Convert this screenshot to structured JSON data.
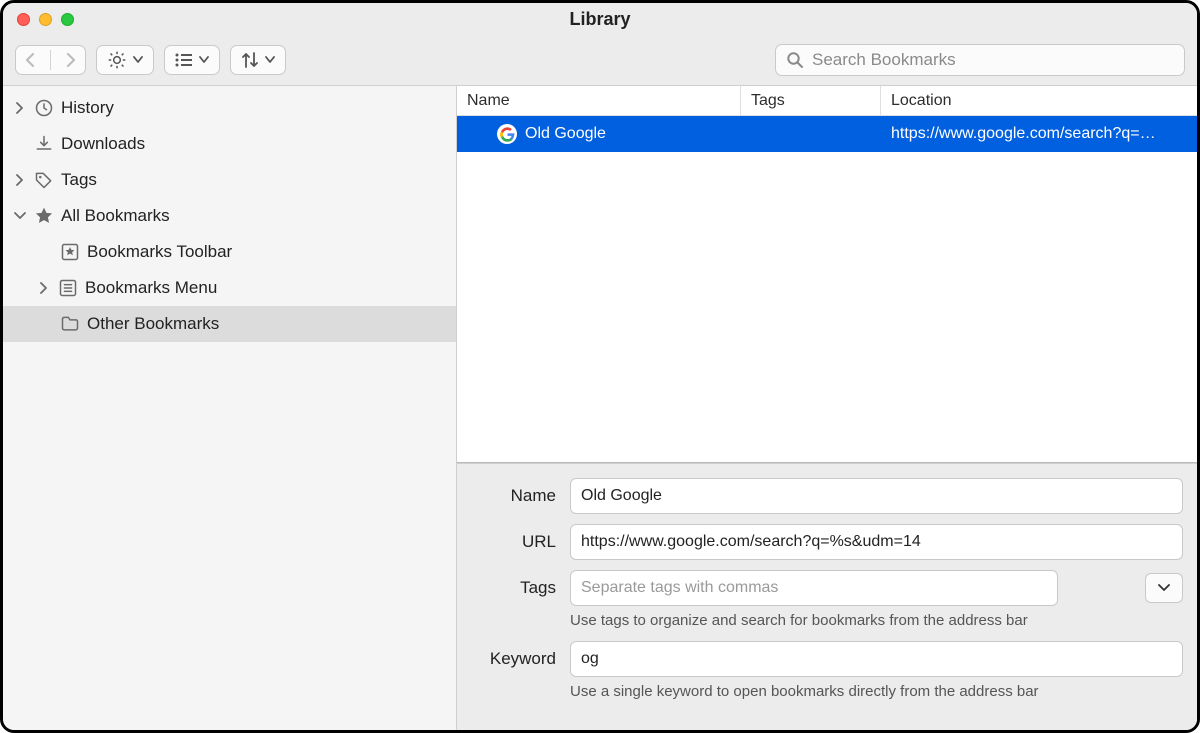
{
  "window": {
    "title": "Library"
  },
  "toolbar": {
    "search_placeholder": "Search Bookmarks"
  },
  "sidebar": {
    "items": [
      {
        "label": "History",
        "icon": "clock-icon",
        "expander": "right"
      },
      {
        "label": "Downloads",
        "icon": "download-icon",
        "expander": ""
      },
      {
        "label": "Tags",
        "icon": "tag-icon",
        "expander": "right"
      },
      {
        "label": "All Bookmarks",
        "icon": "star-icon",
        "expander": "down"
      }
    ],
    "children": [
      {
        "label": "Bookmarks Toolbar",
        "icon": "star-box-icon",
        "expander": ""
      },
      {
        "label": "Bookmarks Menu",
        "icon": "list-icon",
        "expander": "right"
      },
      {
        "label": "Other Bookmarks",
        "icon": "folder-icon",
        "expander": "",
        "selected": true
      }
    ]
  },
  "table": {
    "columns": {
      "name": "Name",
      "tags": "Tags",
      "location": "Location"
    },
    "rows": [
      {
        "name": "Old Google",
        "tags": "",
        "location": "https://www.google.com/search?q=…"
      }
    ]
  },
  "details": {
    "labels": {
      "name": "Name",
      "url": "URL",
      "tags": "Tags",
      "keyword": "Keyword"
    },
    "name": "Old Google",
    "url": "https://www.google.com/search?q=%s&udm=14",
    "tags_placeholder": "Separate tags with commas",
    "tags_hint": "Use tags to organize and search for bookmarks from the address bar",
    "keyword": "og",
    "keyword_hint": "Use a single keyword to open bookmarks directly from the address bar"
  }
}
